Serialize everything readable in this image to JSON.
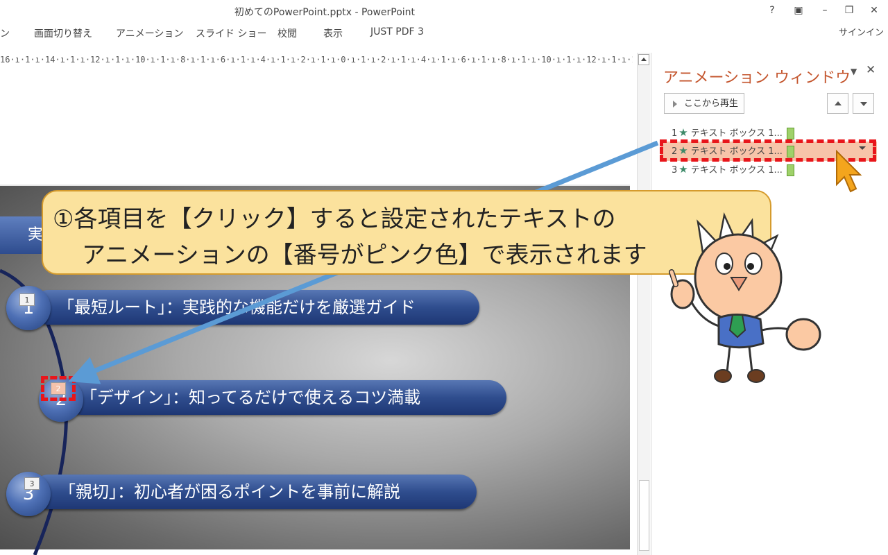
{
  "window": {
    "title": "初めてのPowerPoint.pptx - PowerPoint",
    "help": "?",
    "ribbon_display": "▣",
    "minimize": "–",
    "restore": "❐",
    "close": "✕"
  },
  "ribbon": {
    "tabs": [
      "ン",
      "画面切り替え",
      "アニメーション",
      "スライド ショー",
      "校閲",
      "表示",
      "JUST PDF 3"
    ],
    "signin": "サインイン"
  },
  "ruler": {
    "text": "16·ı·1·ı·14·ı·1·ı·12·ı·1·ı·10·ı·1·ı·8·ı·1·ı·6·ı·1·ı·4·ı·1·ı·2·ı·1·ı·0·ı·1·ı·2·ı·1·ı·4·ı·1·ı·6·ı·1·ı·8·ı·1·ı·10·ı·1·ı·12·ı·1·ı·14·ı·1·ı·16·ı"
  },
  "animation_pane": {
    "title": "アニメーション ウィンドウ",
    "dropdown_icon": "▼",
    "close_icon": "✕",
    "play_button": "ここから再生",
    "items": [
      {
        "number": "1",
        "label": "テキスト ボックス 1..."
      },
      {
        "number": "2",
        "label": "テキスト ボックス 1..."
      },
      {
        "number": "3",
        "label": "テキスト ボックス 1..."
      }
    ]
  },
  "slide": {
    "header_partial": "実",
    "items": [
      {
        "tag": "1",
        "number": "1",
        "text": "「最短ルート」：実践的な機能だけを厳選ガイド"
      },
      {
        "tag": "2",
        "number": "2",
        "text": "「デザイン」：知ってるだけで使えるコツ満載"
      },
      {
        "tag": "3",
        "number": "3",
        "text": "「親切」：初心者が困るポイントを事前に解説"
      }
    ]
  },
  "callout": {
    "line1": "①各項目を【クリック】すると設定されたテキストの",
    "line2": "アニメーションの【番号がピンク色】で表示されます"
  },
  "colors": {
    "pane_title": "#c4562e",
    "highlight_dash": "#e8161b",
    "selected_row": "#f7c4a9",
    "callout_fill": "#fbe29d",
    "arrow": "#5b9bd5",
    "pill_blue": "#2f4d8e"
  }
}
